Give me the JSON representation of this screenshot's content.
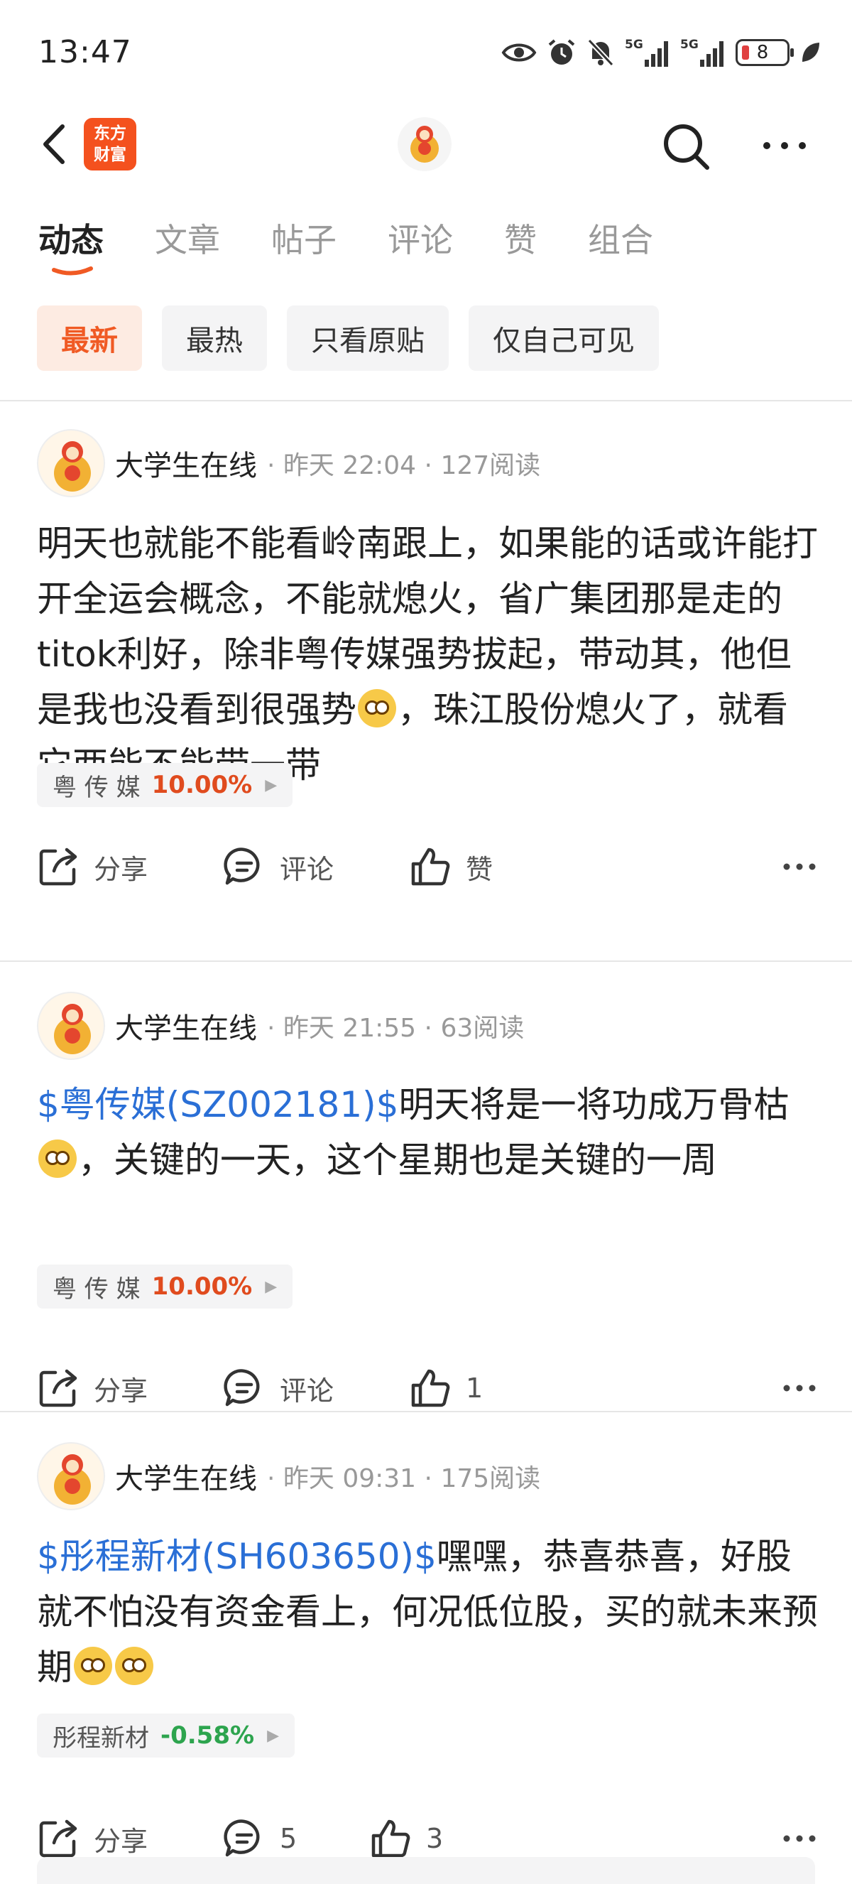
{
  "status_bar": {
    "time": "13:47",
    "battery": "8",
    "icons": [
      "eye-icon",
      "alarm-icon",
      "mute-icon",
      "signal-5g-icon",
      "signal-5g-icon",
      "battery-icon",
      "leaf-icon"
    ]
  },
  "nav": {
    "logo_line1": "东方",
    "logo_line2": "财富",
    "icons": [
      "back-icon",
      "search-icon",
      "more-icon"
    ]
  },
  "tabs": [
    {
      "label": "动态",
      "active": true
    },
    {
      "label": "文章",
      "active": false
    },
    {
      "label": "帖子",
      "active": false
    },
    {
      "label": "评论",
      "active": false
    },
    {
      "label": "赞",
      "active": false
    },
    {
      "label": "组合",
      "active": false
    }
  ],
  "filters": [
    {
      "label": "最新",
      "active": true
    },
    {
      "label": "最热",
      "active": false
    },
    {
      "label": "只看原贴",
      "active": false
    },
    {
      "label": "仅自己可见",
      "active": false
    }
  ],
  "posts": [
    {
      "author": "大学生在线",
      "time": "昨天 22:04",
      "reads": "127阅读",
      "body_before": "明天也就能不能看岭南跟上，如果能的话或许能打开全运会概念，不能就熄火，省广集团那是走的titok利好，除非粤传媒强势拔起，带动其，他但是我也没看到很强势",
      "body_after": "，珠江股份熄火了，就看它两能不能带一带",
      "tag_name": "粤 传 媒",
      "tag_pct": "10.00%",
      "share": "分享",
      "comment": "评论",
      "like": "赞"
    },
    {
      "author": "大学生在线",
      "time": "昨天 21:55",
      "reads": "63阅读",
      "stock": "$粤传媒(SZ002181)$",
      "body_before": "明天将是一将功成万骨枯",
      "body_after": "，关键的一天，这个星期也是关键的一周",
      "tag_name": "粤 传 媒",
      "tag_pct": "10.00%",
      "share": "分享",
      "comment": "评论",
      "like": "1"
    },
    {
      "author": "大学生在线",
      "time": "昨天 09:31",
      "reads": "175阅读",
      "stock": "$彤程新材(SH603650)$",
      "body_before": "嘿嘿，恭喜恭喜，好股就不怕没有资金看上，何况低位股，买的就未来预期",
      "tag_name": "彤程新材",
      "tag_pct": "-0.58%",
      "share": "分享",
      "comment": "5",
      "like": "3"
    }
  ],
  "colors": {
    "accent": "#f05a24",
    "up": "#e04b1e",
    "down": "#2da44e",
    "link": "#2a6fd6"
  }
}
